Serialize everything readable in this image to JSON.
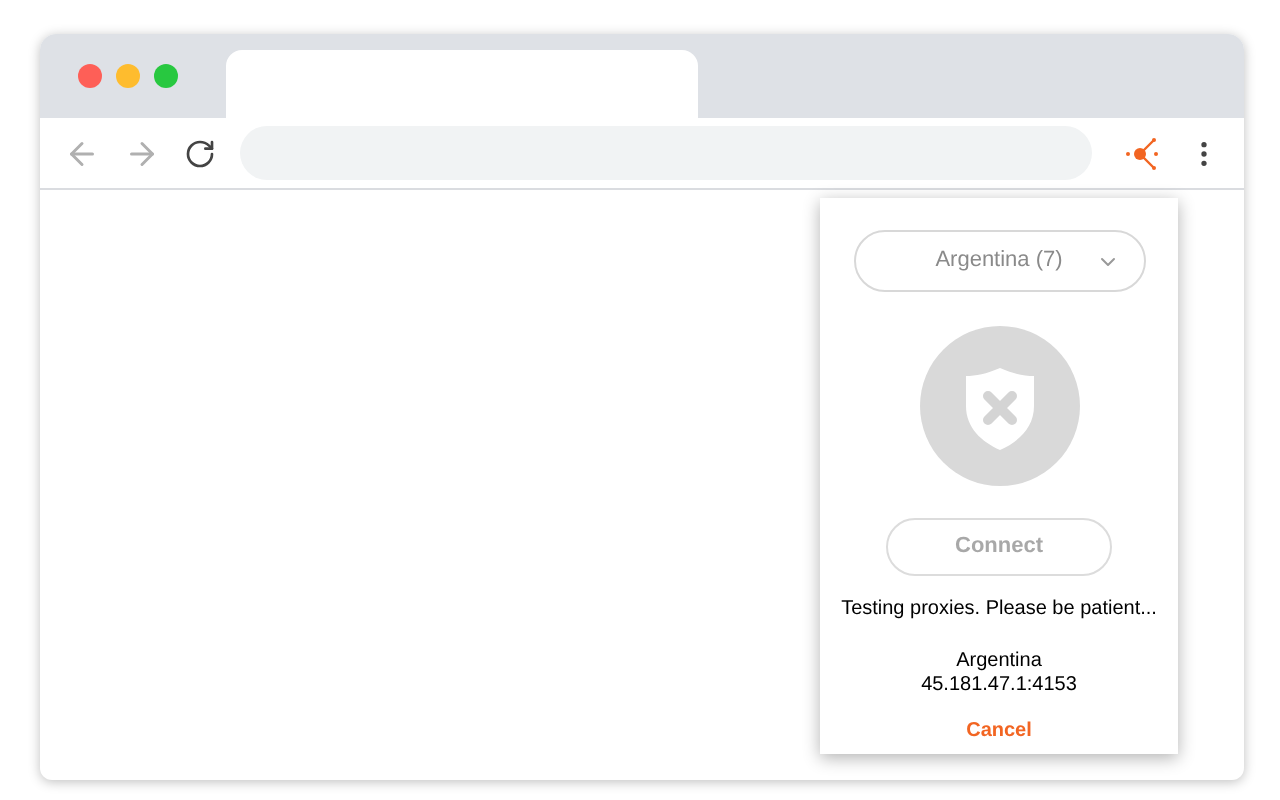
{
  "popup": {
    "country_select": {
      "value": "Argentina (7)"
    },
    "status_icon": {
      "connected": false
    },
    "connect_button": {
      "label": "Connect",
      "disabled": true
    },
    "status_message": "Testing proxies. Please be patient...",
    "proxy_country": "Argentina",
    "proxy_address": "45.181.47.1:4153",
    "cancel_link": "Cancel"
  }
}
